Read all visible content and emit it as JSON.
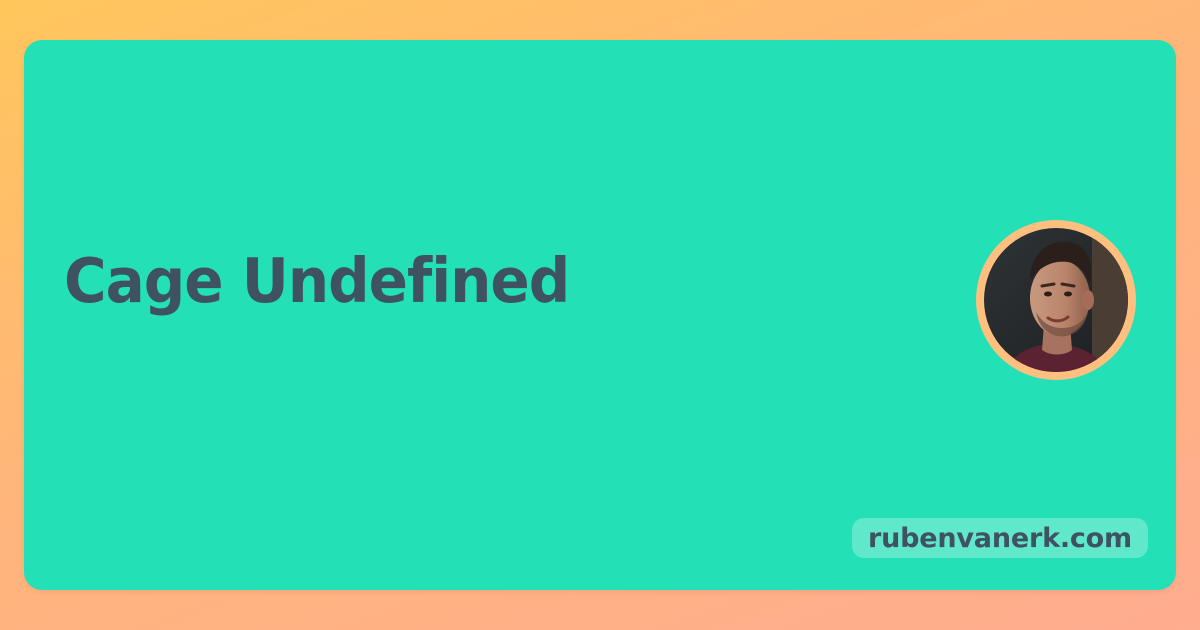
{
  "card": {
    "title": "Cage Undefined",
    "site": "rubenvanerk.com"
  },
  "author": {
    "avatar_icon": "person-photo-icon"
  },
  "colors": {
    "background_from": "#ffc65c",
    "background_to": "#ffac8f",
    "card": "#23e0b7",
    "text": "#3f5262",
    "avatar_ring": "#ffc07f"
  }
}
